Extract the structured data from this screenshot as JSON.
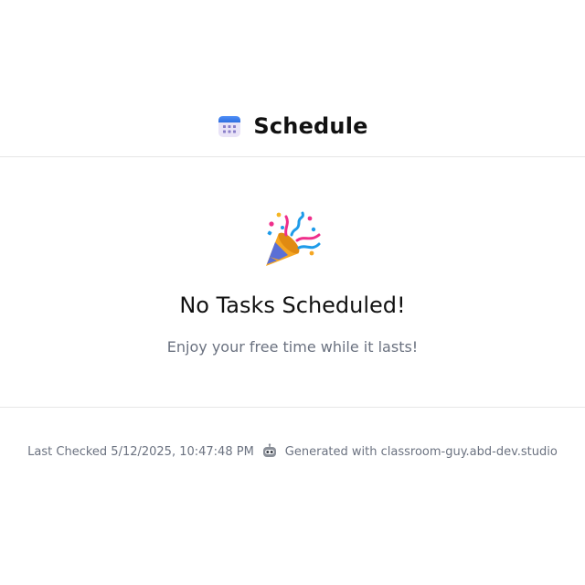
{
  "header": {
    "icon": "calendar-icon",
    "title": "Schedule"
  },
  "empty_state": {
    "icon": "party-popper-icon",
    "title": "No Tasks Scheduled!",
    "subtitle": "Enjoy your free time while it lasts!"
  },
  "footer": {
    "last_checked": "Last Checked 5/12/2025, 10:47:48 PM",
    "icon": "robot-icon",
    "generated_with": "Generated with classroom-guy.abd-dev.studio"
  }
}
